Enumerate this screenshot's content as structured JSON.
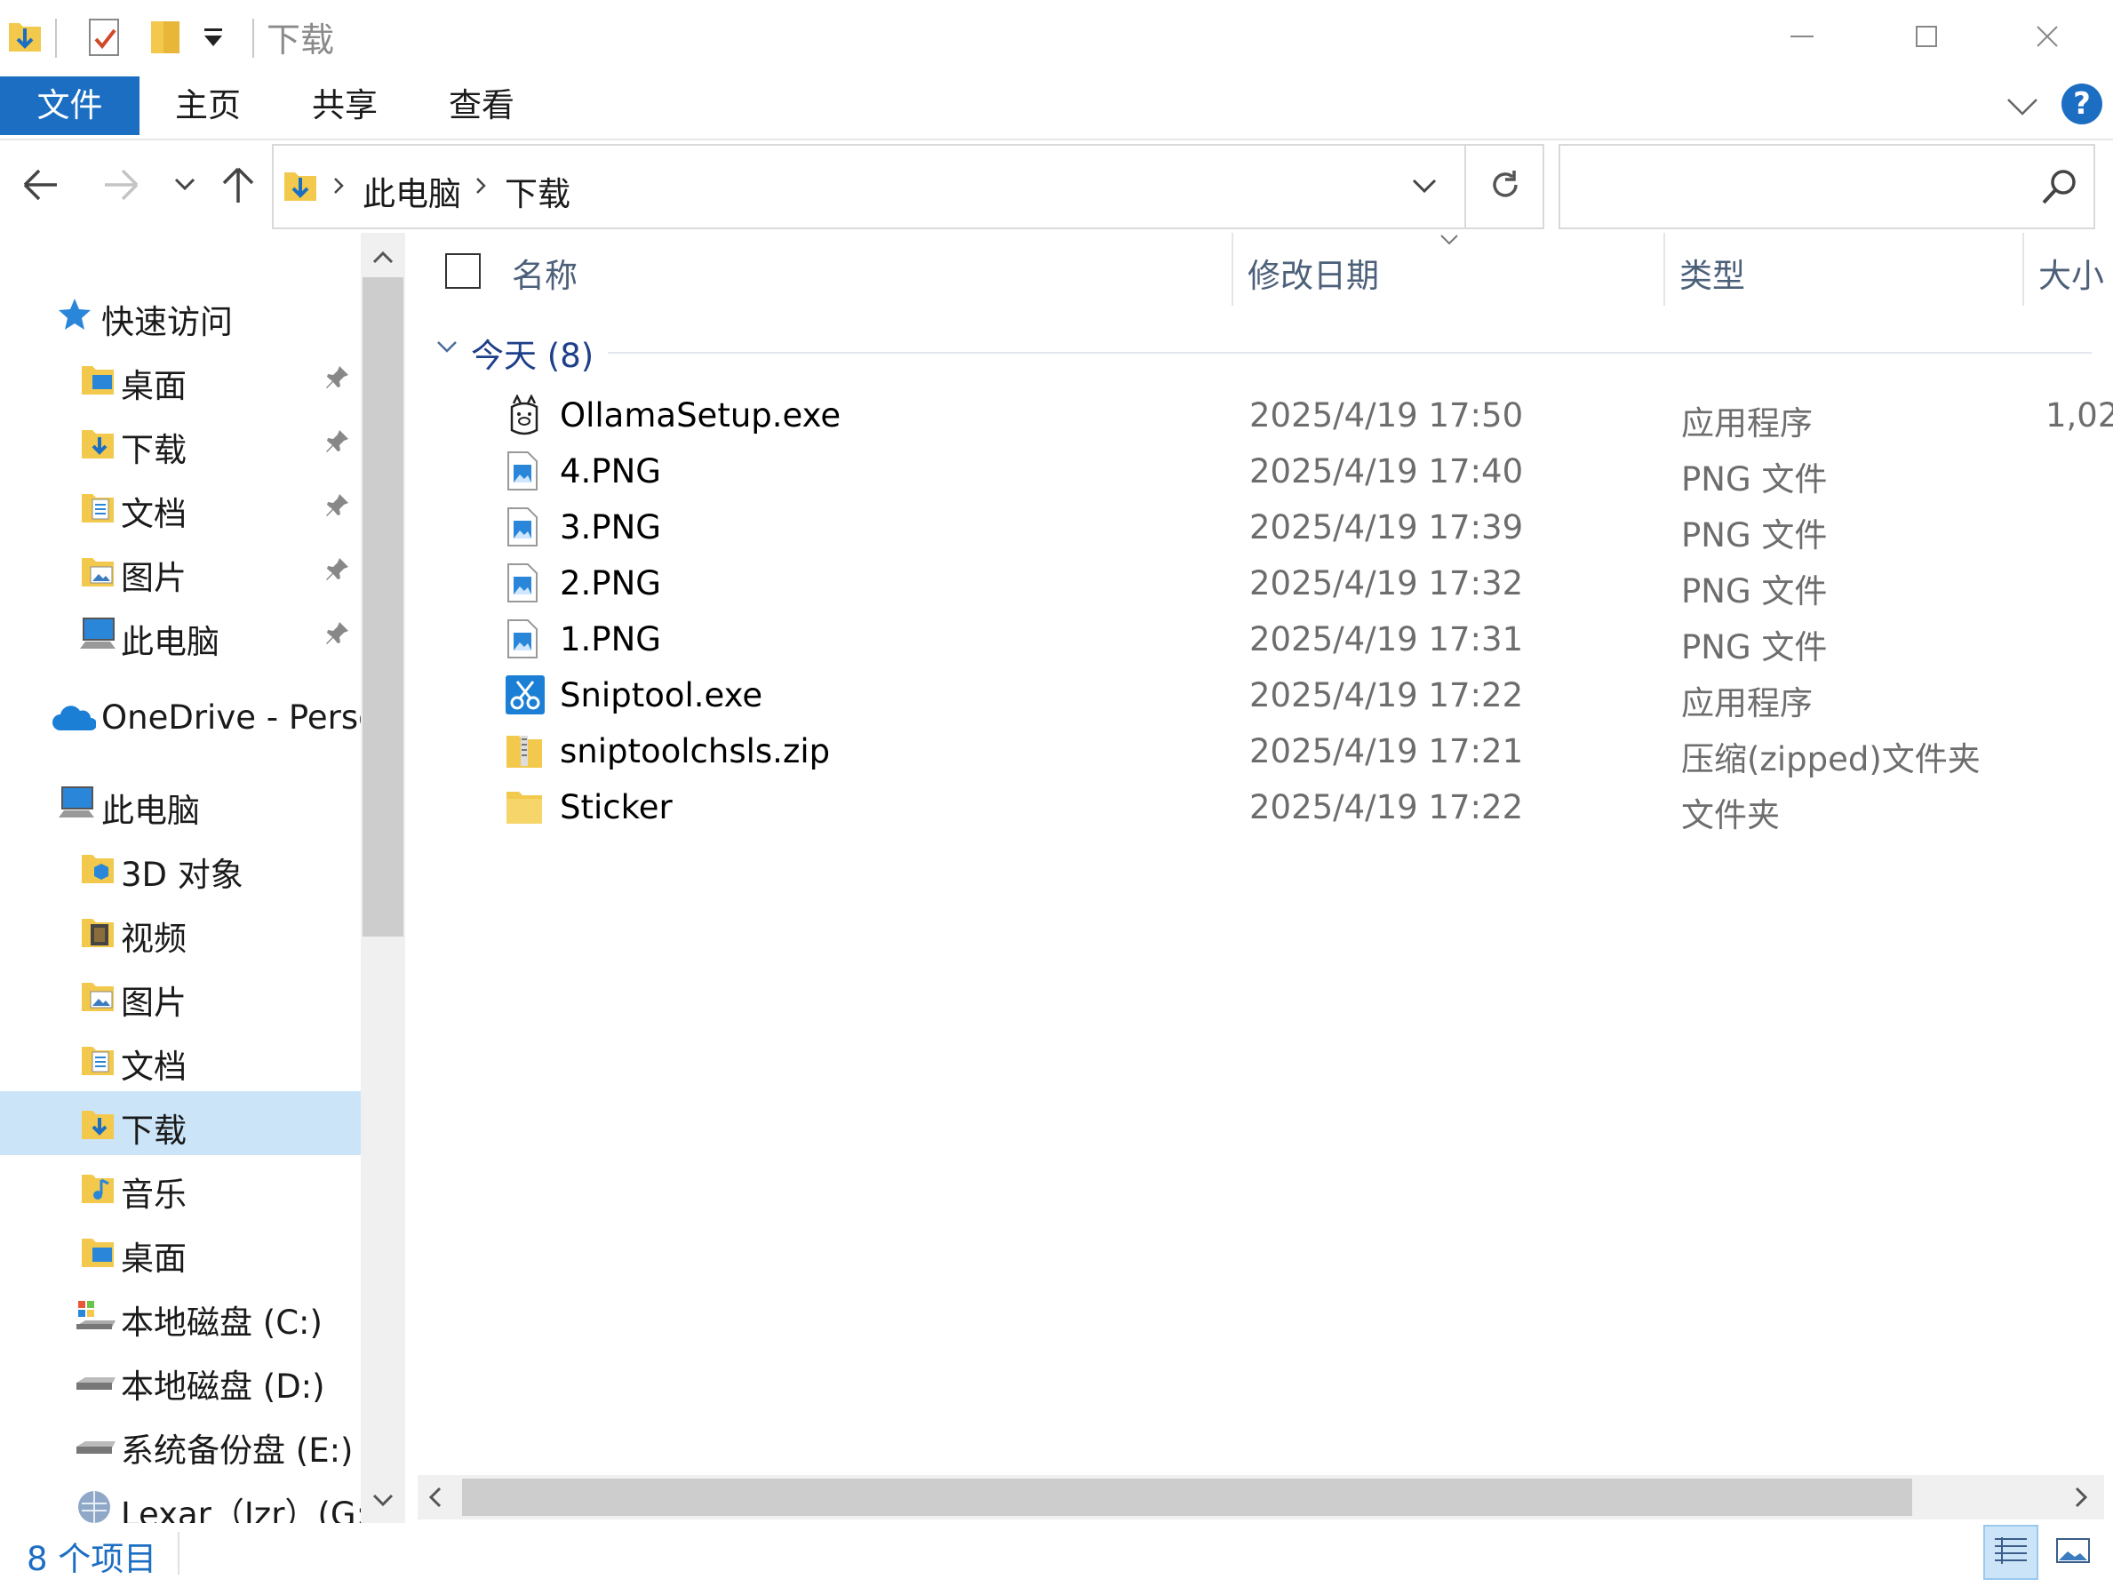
{
  "titlebar": {
    "title": "下载",
    "window_buttons": [
      "minimize-icon",
      "maximize-icon",
      "close-icon"
    ]
  },
  "ribbon": {
    "tabs": [
      "文件",
      "主页",
      "共享",
      "查看"
    ],
    "help": "?"
  },
  "nav": {
    "breadcrumb": [
      "此电脑",
      "下载"
    ],
    "search_placeholder": ""
  },
  "sidebar": {
    "quick_access": "快速访问",
    "pinned": [
      "桌面",
      "下载",
      "文档",
      "图片",
      "此电脑"
    ],
    "onedrive": "OneDrive - Perso",
    "this_pc": "此电脑",
    "pc_items": [
      "3D 对象",
      "视频",
      "图片",
      "文档",
      "下载",
      "音乐",
      "桌面",
      "本地磁盘 (C:)",
      "本地磁盘 (D:)",
      "系统备份盘 (E:)",
      "Lexar（Jzr）(G:"
    ],
    "selected": "下载"
  },
  "columns": {
    "name": "名称",
    "date": "修改日期",
    "type": "类型",
    "size": "大小"
  },
  "group": {
    "label": "今天 (8)"
  },
  "files": [
    {
      "name": "OllamaSetup.exe",
      "date": "2025/4/19 17:50",
      "type": "应用程序",
      "size": "1,02",
      "icon": "ollama-icon"
    },
    {
      "name": "4.PNG",
      "date": "2025/4/19 17:40",
      "type": "PNG 文件",
      "size": "",
      "icon": "image-file-icon"
    },
    {
      "name": "3.PNG",
      "date": "2025/4/19 17:39",
      "type": "PNG 文件",
      "size": "",
      "icon": "image-file-icon"
    },
    {
      "name": "2.PNG",
      "date": "2025/4/19 17:32",
      "type": "PNG 文件",
      "size": "",
      "icon": "image-file-icon"
    },
    {
      "name": "1.PNG",
      "date": "2025/4/19 17:31",
      "type": "PNG 文件",
      "size": "",
      "icon": "image-file-icon"
    },
    {
      "name": "Sniptool.exe",
      "date": "2025/4/19 17:22",
      "type": "应用程序",
      "size": "",
      "icon": "scissors-icon"
    },
    {
      "name": "sniptoolchsls.zip",
      "date": "2025/4/19 17:21",
      "type": "压缩(zipped)文件夹",
      "size": "",
      "icon": "zip-folder-icon"
    },
    {
      "name": "Sticker",
      "date": "2025/4/19 17:22",
      "type": "文件夹",
      "size": "",
      "icon": "folder-icon"
    }
  ],
  "status": {
    "count": "8 个项目"
  },
  "colors": {
    "accent": "#1b6ec2",
    "selection": "#cce4f7",
    "folder": "#f2c94c"
  }
}
